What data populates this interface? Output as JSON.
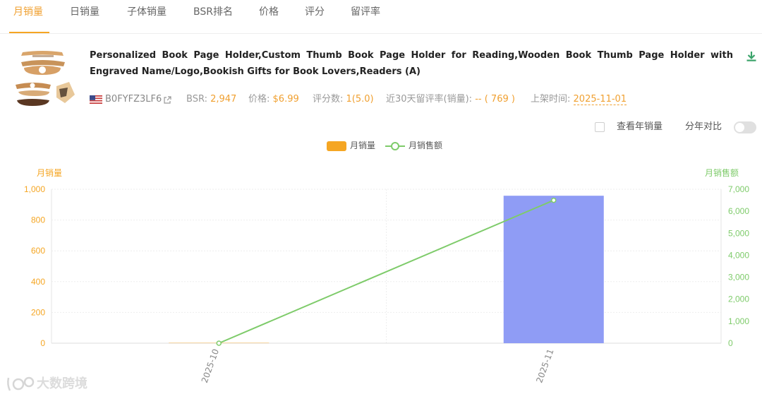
{
  "tabs": [
    {
      "label": "月销量",
      "active": true
    },
    {
      "label": "日销量",
      "active": false
    },
    {
      "label": "子体销量",
      "active": false
    },
    {
      "label": "BSR排名",
      "active": false
    },
    {
      "label": "价格",
      "active": false
    },
    {
      "label": "评分",
      "active": false
    },
    {
      "label": "留评率",
      "active": false
    }
  ],
  "product": {
    "title": "Personalized Book Page Holder,Custom Thumb Book Page Holder for Reading,Wooden Book Thumb Page Holder with Engraved Name/Logo,Bookish Gifts for Book Lovers,Readers (A)",
    "asin": "B0FYFZ3LF6",
    "bsr_label": "BSR:",
    "bsr_value": "2,947",
    "price_label": "价格:",
    "price_value": "$6.99",
    "rating_label": "评分数:",
    "rating_value": "1(5.0)",
    "review_rate_label": "近30天留评率(销量):",
    "review_rate_value": "-- ( 769 )",
    "listed_label": "上架时间:",
    "listed_value": "2025-11-01"
  },
  "options": {
    "yearly_sales_label": "查看年销量",
    "yearly_sales_checked": false,
    "year_compare_label": "分年对比",
    "year_compare_on": false
  },
  "legend": {
    "bar_label": "月销量",
    "line_label": "月销售额"
  },
  "chart_data": {
    "type": "bar",
    "categories": [
      "2025-10",
      "2025-11"
    ],
    "series": [
      {
        "name": "月销量",
        "type": "bar",
        "axis": "left",
        "values": [
          3,
          958
        ],
        "colors": [
          "#f5d5a0",
          "#8f9cf5"
        ]
      },
      {
        "name": "月销售额",
        "type": "line",
        "axis": "right",
        "values": [
          0,
          6500
        ],
        "color": "#7ecb6a"
      }
    ],
    "left_axis": {
      "label": "月销量",
      "min": 0,
      "max": 1000,
      "ticks": [
        0,
        200,
        400,
        600,
        800,
        1000
      ],
      "tick_labels": [
        "0",
        "200",
        "400",
        "600",
        "800",
        "1,000"
      ],
      "color": "#f5a623"
    },
    "right_axis": {
      "label": "月销售额",
      "min": 0,
      "max": 7000,
      "ticks": [
        0,
        1000,
        2000,
        3000,
        4000,
        5000,
        6000,
        7000
      ],
      "tick_labels": [
        "0",
        "1,000",
        "2,000",
        "3,000",
        "4,000",
        "5,000",
        "6,000",
        "7,000"
      ],
      "color": "#7ecb6a"
    },
    "grid": true,
    "legend_position": "top-center"
  },
  "watermark": {
    "text": "大数跨境"
  },
  "icons": {
    "flag": "us-flag-icon",
    "external_link": "external-link-icon",
    "download": "download-icon"
  },
  "colors": {
    "accent": "#f5a623",
    "accent_text": "#f0a030",
    "line": "#7ecb6a",
    "bar_highlight": "#8f9cf5"
  }
}
